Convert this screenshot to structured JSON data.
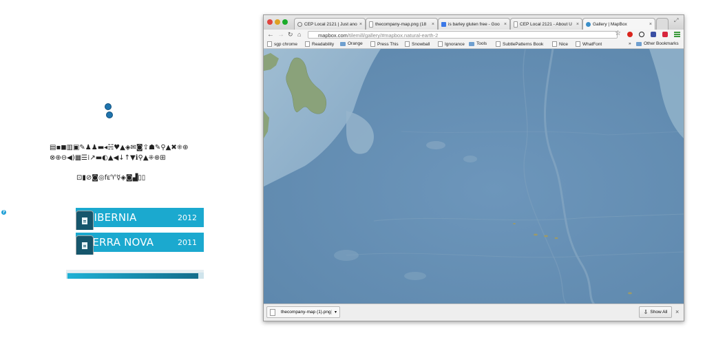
{
  "left_panel": {
    "icon_row_1": "▤▪◼▥▣✎♟♟▬◂☵♥▲◈✉◙⇪☗✎⚲▲✖⁜⊕",
    "icon_row_2": "⊗⊕⊖◀)▦☰⁞↗▬◐▲◀↓↑▼ℹ⚲▲⁜⊕⊞",
    "icon_row_3": "⊡▮⊘◙◎fᴇ♈☿◈◙▟▯▯",
    "cards": [
      {
        "name": "HIBERNIA",
        "year": "2012"
      },
      {
        "name": "TERRA NOVA",
        "year": "2011"
      }
    ]
  },
  "browser": {
    "tabs": [
      {
        "label": "CEP Local 2121 | Just ano"
      },
      {
        "label": "thecompany-map.png (18"
      },
      {
        "label": "is barley gluten free - Goo"
      },
      {
        "label": "CEP Local 2121 - About U"
      },
      {
        "label": "Gallery | MapBox"
      }
    ],
    "url_host": "mapbox.com",
    "url_path": "/tilemill/gallery/#mapbox.natural-earth-2",
    "bookmarks": [
      {
        "label": "sgp chrome",
        "type": "page"
      },
      {
        "label": "Readability",
        "type": "page"
      },
      {
        "label": "Orange",
        "type": "folder"
      },
      {
        "label": "Press This",
        "type": "page"
      },
      {
        "label": "Snowball",
        "type": "page"
      },
      {
        "label": "Ignorance",
        "type": "page"
      },
      {
        "label": "Tools",
        "type": "folder"
      },
      {
        "label": "SubtlePatterns Book",
        "type": "page"
      },
      {
        "label": "Nice",
        "type": "page"
      },
      {
        "label": "WhatFont",
        "type": "page"
      }
    ],
    "other_bookmarks": "Other Bookmarks",
    "download_file": "thecompany-map (1).png",
    "show_all": "Show All"
  },
  "colors": {
    "card_tab": "#16566c",
    "card_body": "#1ba9cf",
    "ocean": "#6a93b6",
    "land": "#8aa27a"
  }
}
